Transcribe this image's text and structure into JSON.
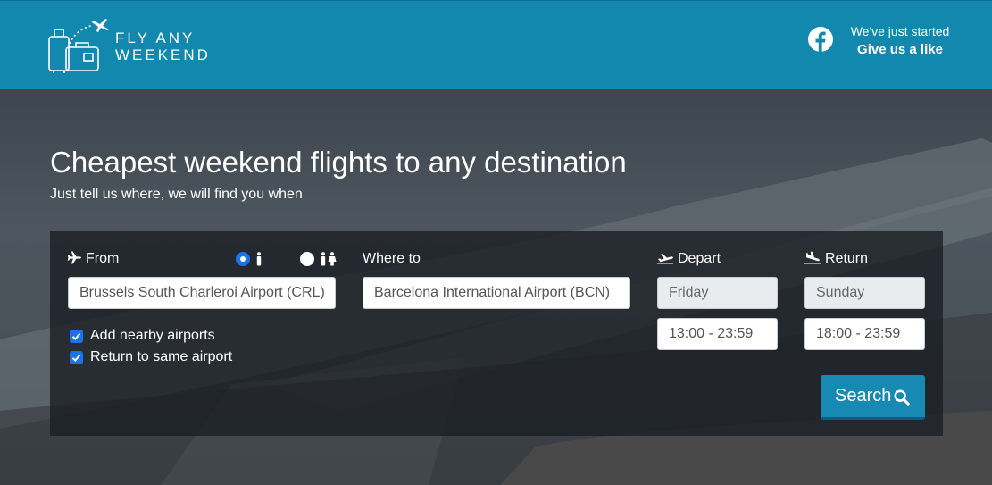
{
  "header": {
    "logo_line1": "FLY ANY",
    "logo_line2": "WEEKEND",
    "social_line1": "We've just started",
    "social_line2": "Give us a like",
    "brand_color": "#1388ae",
    "social_icon": "facebook-icon"
  },
  "hero": {
    "title": "Cheapest weekend flights to any destination",
    "subtitle": "Just tell us where, we will find you when"
  },
  "search_form": {
    "from_label": "From",
    "to_label": "Where to",
    "depart_label": "Depart",
    "return_label": "Return",
    "travelers": {
      "options": [
        "single-person-icon",
        "two-people-icon"
      ],
      "selected": "single-person-icon"
    },
    "from_value": "Brussels South Charleroi Airport (CRL)",
    "to_value": "Barcelona International Airport (BCN)",
    "depart_day": "Friday",
    "depart_time": "13:00 - 23:59",
    "return_day": "Sunday",
    "return_time": "18:00 - 23:59",
    "add_nearby_label": "Add nearby airports",
    "add_nearby_checked": true,
    "same_airport_label": "Return to same airport",
    "same_airport_checked": true,
    "search_label": "Search",
    "accent_color": "#1a73e8"
  }
}
